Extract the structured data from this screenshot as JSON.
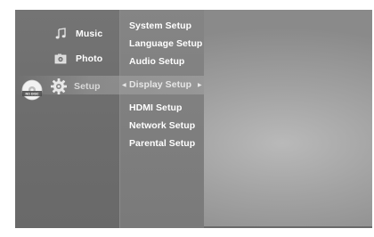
{
  "main_menu": {
    "items": [
      {
        "label": "Music",
        "icon": "music-icon"
      },
      {
        "label": "Photo",
        "icon": "photo-icon"
      },
      {
        "label": "Setup",
        "icon": "gear-icon"
      }
    ],
    "active_indicator_icon": "disc-icon",
    "active_indicator_label": "NO DISC"
  },
  "setup_menu": {
    "items": [
      "System Setup",
      "Language Setup",
      "Audio Setup",
      "Display Setup",
      "HDMI Setup",
      "Network Setup",
      "Parental Setup"
    ],
    "selected": "Display Setup"
  },
  "colors": {
    "panel_left": "#6f6f6f",
    "panel_sub": "#808080",
    "text": "#ffffff",
    "background": "#a8a8a8"
  }
}
